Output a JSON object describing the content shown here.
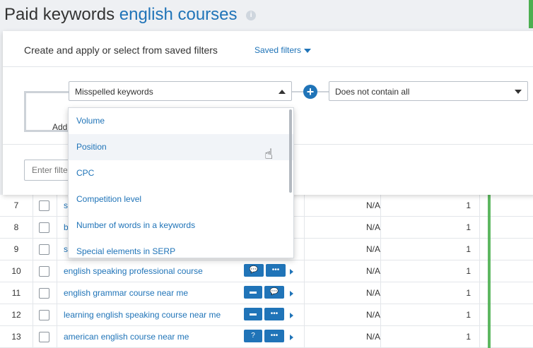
{
  "header": {
    "title_prefix": "Paid keywords",
    "title_keyword": "english courses",
    "info_icon": "i"
  },
  "panel": {
    "title": "Create and apply or select from saved filters",
    "saved_filters": "Saved filters",
    "select_left": "Misspelled keywords",
    "select_right": "Does not contain all",
    "add_label": "Add",
    "enter_filter_placeholder": "Enter filte"
  },
  "dropdown": {
    "items": [
      "Volume",
      "Position",
      "CPC",
      "Competition level",
      "Number of words in a keywords",
      "Special elements in SERP"
    ]
  },
  "table": {
    "rows": [
      {
        "num": "7",
        "keyword": "s",
        "na": "N/A",
        "val": "1"
      },
      {
        "num": "8",
        "keyword": "b",
        "na": "N/A",
        "val": "1"
      },
      {
        "num": "9",
        "keyword": "s",
        "na": "N/A",
        "val": "1"
      },
      {
        "num": "10",
        "keyword": "english speaking professional course",
        "na": "N/A",
        "val": "1",
        "b1": "💬",
        "b2": "•••"
      },
      {
        "num": "11",
        "keyword": "english grammar course near me",
        "na": "N/A",
        "val": "1",
        "b1": "▬",
        "b2": "💬"
      },
      {
        "num": "12",
        "keyword": "learning english speaking course near me",
        "na": "N/A",
        "val": "1",
        "b1": "▬",
        "b2": "•••"
      },
      {
        "num": "13",
        "keyword": "american english course near me",
        "na": "N/A",
        "val": "1",
        "b1": "?",
        "b2": "•••"
      }
    ]
  },
  "colors": {
    "accent": "#2074b8",
    "green": "#4caf50"
  }
}
